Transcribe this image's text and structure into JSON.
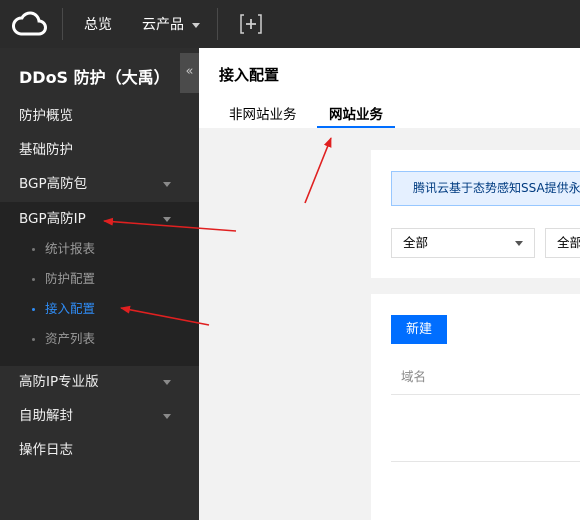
{
  "topbar": {
    "logo_icon": "cloud-logo-icon",
    "overview_label": "总览",
    "products_label": "云产品",
    "add_icon": "add-shortcut-icon"
  },
  "sidebar": {
    "title": "DDoS 防护（大禹）",
    "collapse_glyph": "«",
    "items": [
      {
        "label": "防护概览",
        "expandable": false
      },
      {
        "label": "基础防护",
        "expandable": false
      },
      {
        "label": "BGP高防包",
        "expandable": true
      },
      {
        "label": "BGP高防IP",
        "expandable": true,
        "expanded": true
      }
    ],
    "sub_items": [
      {
        "label": "统计报表",
        "active": false
      },
      {
        "label": "防护配置",
        "active": false
      },
      {
        "label": "接入配置",
        "active": true
      },
      {
        "label": "资产列表",
        "active": false
      }
    ],
    "items_after": [
      {
        "label": "高防IP专业版",
        "expandable": true
      },
      {
        "label": "自助解封",
        "expandable": true
      },
      {
        "label": "操作日志",
        "expandable": false
      }
    ]
  },
  "main": {
    "page_title": "接入配置",
    "tabs": [
      {
        "label": "非网站业务",
        "active": false
      },
      {
        "label": "网站业务",
        "active": true
      }
    ],
    "notice_text": "腾讯云基于态势感知SSA提供永",
    "filters": [
      {
        "selected": "全部"
      },
      {
        "selected": "全部"
      }
    ],
    "new_button_label": "新建",
    "table_headers": [
      "域名"
    ]
  },
  "colors": {
    "accent": "#006eff",
    "sidebar_active": "#2f8cf5",
    "annotation_arrow": "#e02020",
    "topbar_bg": "#2b2b2b",
    "sidebar_bg": "#2e2e2e"
  }
}
